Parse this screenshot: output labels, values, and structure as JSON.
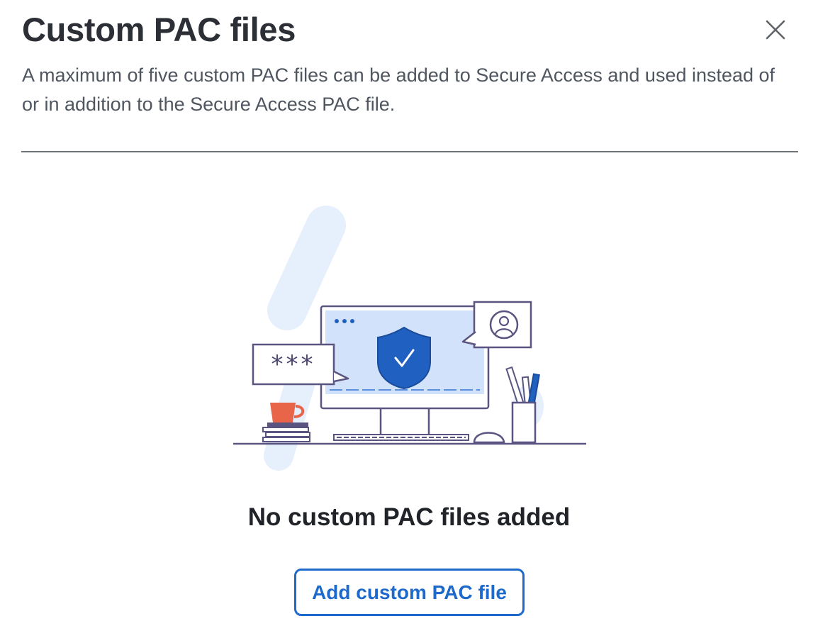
{
  "panel": {
    "title": "Custom PAC files",
    "description": "A maximum of five custom PAC files can be added to Secure Access and used instead of or in addition to the Secure Access PAC file.",
    "close_icon": "close-icon"
  },
  "empty_state": {
    "illustration": "secure-desktop-illustration",
    "message": "No custom PAC files added",
    "add_button_label": "Add custom PAC file"
  },
  "colors": {
    "title": "#2c3036",
    "body_text": "#4f5660",
    "accent": "#1d69cc",
    "shield": "#2060c0",
    "illustration_outline": "#5a5580",
    "illustration_bg": "#e6effc",
    "cup": "#e8654a"
  }
}
